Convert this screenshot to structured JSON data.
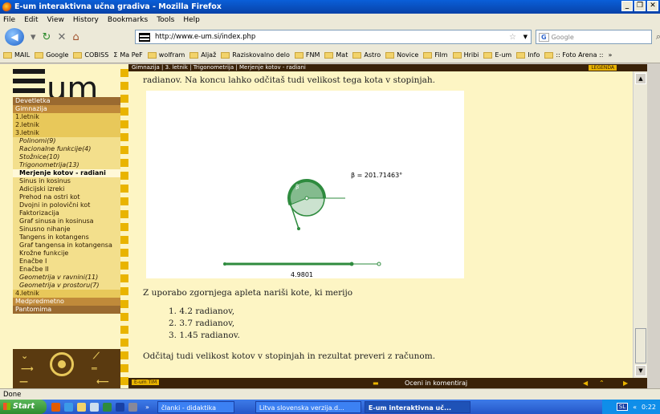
{
  "window": {
    "title": "E-um interaktivna učna gradiva - Mozilla Firefox",
    "controls": [
      "_",
      "❐",
      "✕"
    ]
  },
  "menubar": [
    "File",
    "Edit",
    "View",
    "History",
    "Bookmarks",
    "Tools",
    "Help"
  ],
  "navbar": {
    "url": "http://www.e-um.si/index.php",
    "search_placeholder": "Google",
    "search_engine": "G"
  },
  "bookmarks": [
    "MAIL",
    "Google",
    "COBISS",
    "Ma PeF",
    "wolfram",
    "Aljaž",
    "Raziskovalno delo",
    "FNM",
    "Mat",
    "Astro",
    "Novice",
    "Film",
    "Hribi",
    "E-um",
    "Info",
    ":: Foto Arena ::",
    "»"
  ],
  "site": {
    "logo_text": "um",
    "breadcrumb": "Gimnazija | 3. letnik | Trigonometrija | Merjenje kotov - radiani",
    "legend_label": "LEGENDA",
    "bottom_tag": "E-um TIM",
    "rate_link": "Oceni in komentiraj"
  },
  "sidebar": {
    "items": [
      {
        "label": "Devetletka",
        "style": "section"
      },
      {
        "label": "Gimnazija",
        "style": "dark"
      },
      {
        "label": "1.letnik",
        "style": "gold"
      },
      {
        "label": "2.letnik",
        "style": "gold"
      },
      {
        "label": "3.letnik",
        "style": "gold"
      },
      {
        "label": "Polinomi(9)",
        "style": "sub italic"
      },
      {
        "label": "Racionalne funkcije(4)",
        "style": "sub italic"
      },
      {
        "label": "Stožnice(10)",
        "style": "sub italic"
      },
      {
        "label": "Trigonometrija(13)",
        "style": "sub italic"
      },
      {
        "label": "Merjenje kotov - radiani",
        "style": "active"
      },
      {
        "label": "Sinus in kosinus",
        "style": "sub"
      },
      {
        "label": "Adicijski izreki",
        "style": "sub"
      },
      {
        "label": "Prehod na ostri kot",
        "style": "sub"
      },
      {
        "label": "Dvojni in polovični kot",
        "style": "sub"
      },
      {
        "label": "Faktorizacija",
        "style": "sub"
      },
      {
        "label": "Graf sinusa in kosinusa",
        "style": "sub"
      },
      {
        "label": "Sinusno nihanje",
        "style": "sub"
      },
      {
        "label": "Tangens in kotangens",
        "style": "sub"
      },
      {
        "label": "Graf tangensa in kotangensa",
        "style": "sub"
      },
      {
        "label": "Krožne funkcije",
        "style": "sub"
      },
      {
        "label": "Enačbe I",
        "style": "sub"
      },
      {
        "label": "Enačbe II",
        "style": "sub"
      },
      {
        "label": "Geometrija v ravnini(11)",
        "style": "sub italic"
      },
      {
        "label": "Geometrija v prostoru(7)",
        "style": "sub italic"
      },
      {
        "label": "4.letnik",
        "style": "gold"
      },
      {
        "label": "Medpredmetno",
        "style": "dark"
      },
      {
        "label": "Pantomima",
        "style": "section"
      }
    ]
  },
  "main": {
    "intro": "radianov. Na koncu lahko odčitaš tudi velikost tega kota v stopinjah.",
    "applet": {
      "angle_label": "β = 201.71463°",
      "arc_label": "β",
      "slider_value": "4.9801"
    },
    "task": "Z uporabo zgornjega apleta nariši kote, ki merijo",
    "list": [
      "1.  4.2 radianov,",
      "2.  3.7 radianov,",
      "3.  1.45 radianov."
    ],
    "outro": "Odčitaj tudi velikost kotov v stopinjah in rezultat preveri z računom."
  },
  "status": "Done",
  "taskbar": {
    "start": "Start",
    "tasks": [
      "članki - didaktika",
      "Litva slovenska verzija.d...",
      "E-um interaktivna uč..."
    ],
    "lang": "SL",
    "time": "0:22",
    "chevrons": "»",
    "tray_chevron": "«"
  },
  "colors": {
    "page_bg": "#fdf5c4",
    "accent_brown": "#3a2208",
    "accent_gold": "#e9b400",
    "applet_green": "#2e8b3e"
  }
}
